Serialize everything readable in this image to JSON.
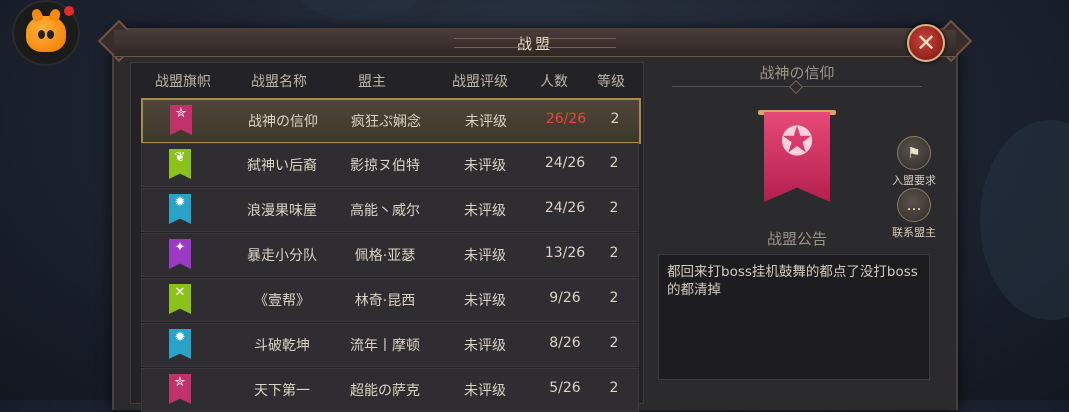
{
  "panel": {
    "title": "战盟",
    "close_glyph": "✕"
  },
  "table": {
    "headers": [
      "战盟旗帜",
      "战盟名称",
      "盟主",
      "战盟评级",
      "人数",
      "等级"
    ],
    "rows": [
      {
        "flag_icon": "star-flag-icon",
        "flag_color": "#c0326a",
        "flag_glyph": "✮",
        "name": "战神の信仰",
        "leader": "疯狂ぷ娴念",
        "rating": "未评级",
        "members": "26/26",
        "members_full": true,
        "level": "2",
        "selected": true
      },
      {
        "flag_icon": "leaf-flag-icon",
        "flag_color": "#8ac21a",
        "flag_glyph": "❦",
        "name": "弑神い后裔",
        "leader": "影掠ヌ伯特",
        "rating": "未评级",
        "members": "24/26",
        "members_full": false,
        "level": "2",
        "selected": false
      },
      {
        "flag_icon": "gem-flag-icon",
        "flag_color": "#2aa3c8",
        "flag_glyph": "✹",
        "name": "浪漫果味屋",
        "leader": "高能丶威尔",
        "rating": "未评级",
        "members": "24/26",
        "members_full": false,
        "level": "2",
        "selected": false
      },
      {
        "flag_icon": "swirl-flag-icon",
        "flag_color": "#9b3ac4",
        "flag_glyph": "✦",
        "name": "暴走小分队",
        "leader": "佩格·亚瑟",
        "rating": "未评级",
        "members": "13/26",
        "members_full": false,
        "level": "2",
        "selected": false
      },
      {
        "flag_icon": "swords-flag-icon",
        "flag_color": "#8ac21a",
        "flag_glyph": "✕",
        "name": "《壹帮》",
        "leader": "林奇·昆西",
        "rating": "未评级",
        "members": "9/26",
        "members_full": false,
        "level": "2",
        "selected": false
      },
      {
        "flag_icon": "gem-flag-icon",
        "flag_color": "#2aa3c8",
        "flag_glyph": "✹",
        "name": "斗破乾坤",
        "leader": "流年丨摩顿",
        "rating": "未评级",
        "members": "8/26",
        "members_full": false,
        "level": "2",
        "selected": false
      },
      {
        "flag_icon": "star-flag-icon",
        "flag_color": "#c0326a",
        "flag_glyph": "✮",
        "name": "天下第一",
        "leader": "超能の萨克",
        "rating": "未评级",
        "members": "5/26",
        "members_full": false,
        "level": "2",
        "selected": false
      }
    ]
  },
  "detail": {
    "guild_name": "战神の信仰",
    "banner_icon": "star-banner-icon",
    "banner_glyph": "✪",
    "join_requirements_label": "入盟要求",
    "contact_leader_label": "联系盟主",
    "notice_title": "战盟公告",
    "notice_text": "都回来打boss挂机鼓舞的都点了没打boss的都清掉"
  },
  "colors": {
    "accent_red": "#e14a34",
    "selected_border": "#a98a4e"
  }
}
